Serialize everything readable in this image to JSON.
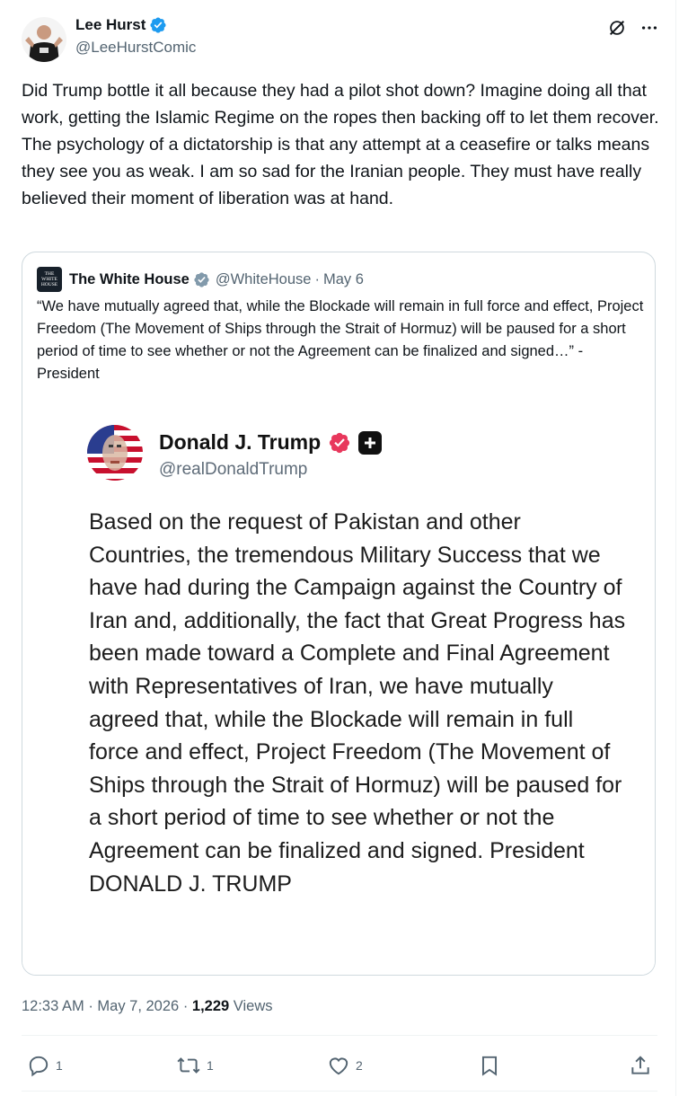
{
  "author": {
    "name": "Lee Hurst",
    "handle": "@LeeHurstComic",
    "avatar_icon": "person-avatar"
  },
  "top_icons": [
    "grok-icon",
    "more-icon"
  ],
  "tweet": {
    "text": "Did Trump bottle it all because they had a pilot shot down? Imagine doing all that work, getting the Islamic Regime on the ropes then backing off to let them recover. The psychology of a dictatorship is that any attempt at a ceasefire or talks means they see you as weak. I am so sad for the Iranian people. They must have really believed their moment of liberation was at hand."
  },
  "quote": {
    "logo_text": "THE WHITE HOUSE",
    "name": "The White House",
    "handle": "@WhiteHouse",
    "separator": "·",
    "date": "May 6",
    "text": "“We have mutually agreed that, while the Blockade will remain in full force and effect, Project Freedom (The Movement of Ships through the Strait of Hormuz) will be paused for a short period of time to see whether or not the Agreement can be finalized and signed…” - President",
    "embedded": {
      "name": "Donald J. Trump",
      "handle": "@realDonaldTrump",
      "body": "Based on the request of Pakistan and other Countries, the tremendous Military Success that we have had during the Campaign against the Country of Iran and, additionally, the fact that Great Progress has been made toward a Complete and Final Agreement with Representatives of Iran, we have mutually agreed that, while the Blockade will remain in full force and effect, Project Freedom (The Movement of Ships through the Strait of Hormuz) will be paused for a short period of time to see whether or not the Agreement can be finalized and signed. President DONALD J. TRUMP"
    }
  },
  "meta": {
    "time": "12:33 AM",
    "dot1": "·",
    "date": "May 7, 2026",
    "dot2": "·",
    "views_count": "1,229",
    "views_label": "Views"
  },
  "actions": {
    "replies": "1",
    "reposts": "1",
    "likes": "2"
  },
  "colors": {
    "verified_blue": "#1d9bf0",
    "verified_gray": "#829aab",
    "truth_badge": "#e8375c",
    "muted": "#536471"
  }
}
